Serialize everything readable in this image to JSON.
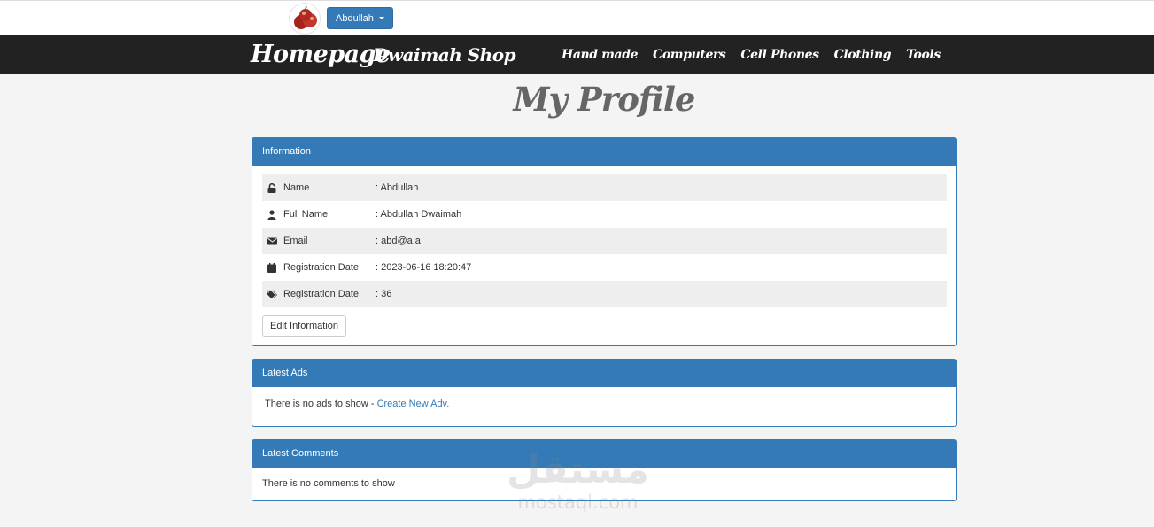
{
  "topbar": {
    "user_button": "Abdullah"
  },
  "navbar": {
    "brand": "Homepage",
    "shop_name": "Dwaimah Shop",
    "categories": [
      "Hand made",
      "Computers",
      "Cell Phones",
      "Clothing",
      "Tools"
    ]
  },
  "page_title": "My Profile",
  "info_panel": {
    "heading": "Information",
    "rows": [
      {
        "icon": "unlock-icon",
        "label": "Name",
        "value": ": Abdullah"
      },
      {
        "icon": "user-icon",
        "label": "Full Name",
        "value": ": Abdullah Dwaimah"
      },
      {
        "icon": "envelope-icon",
        "label": "Email",
        "value": ": abd@a.a"
      },
      {
        "icon": "calendar-icon",
        "label": "Registration Date",
        "value": ": 2023-06-16 18:20:47"
      },
      {
        "icon": "tags-icon",
        "label": "Registration Date",
        "value": ": 36"
      }
    ],
    "edit_button": "Edit Information"
  },
  "ads_panel": {
    "heading": "Latest Ads",
    "message": "There is no ads to show -",
    "link": "Create New Adv."
  },
  "comments_panel": {
    "heading": "Latest Comments",
    "message": "There is no comments to show"
  },
  "watermark": {
    "arabic": "مستقل",
    "latin": "mostaql.com"
  },
  "colors": {
    "primary": "#337ab7",
    "navbar": "#222222",
    "background": "#f4f4f4"
  }
}
